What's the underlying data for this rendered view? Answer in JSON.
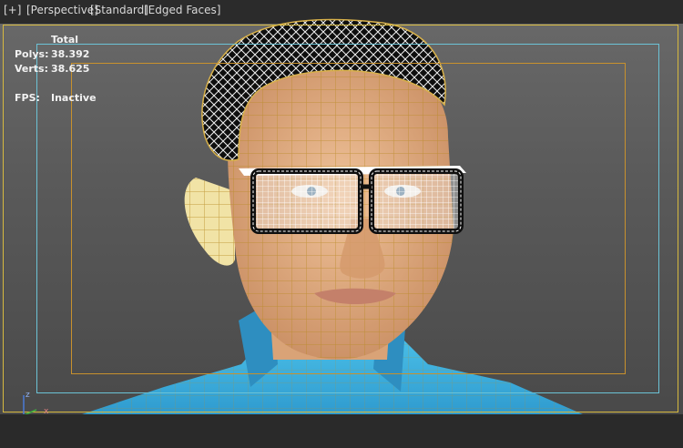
{
  "viewport": {
    "labels": {
      "plus": "[+]",
      "perspective": "[Perspective]",
      "standard": "[Standard]",
      "edged": "[Edged Faces]"
    }
  },
  "stats": {
    "header": "Total",
    "polys_label": "Polys:",
    "polys_value": "38.392",
    "verts_label": "Verts:",
    "verts_value": "38.625",
    "fps_label": "FPS:",
    "fps_value": "Inactive"
  },
  "axis": {
    "z_label": "z",
    "x_label": "x",
    "colors": {
      "z": "#4a7bd8",
      "x": "#d84040",
      "y": "#3fb03f"
    }
  },
  "colors": {
    "frame_outer": "#d6b93f",
    "safe_cyan": "#6cc3d6",
    "safe_orange": "#c8912d",
    "skin": "#e7b58a",
    "wire": "#c99a2b",
    "shirt": "#3fb4e0"
  }
}
